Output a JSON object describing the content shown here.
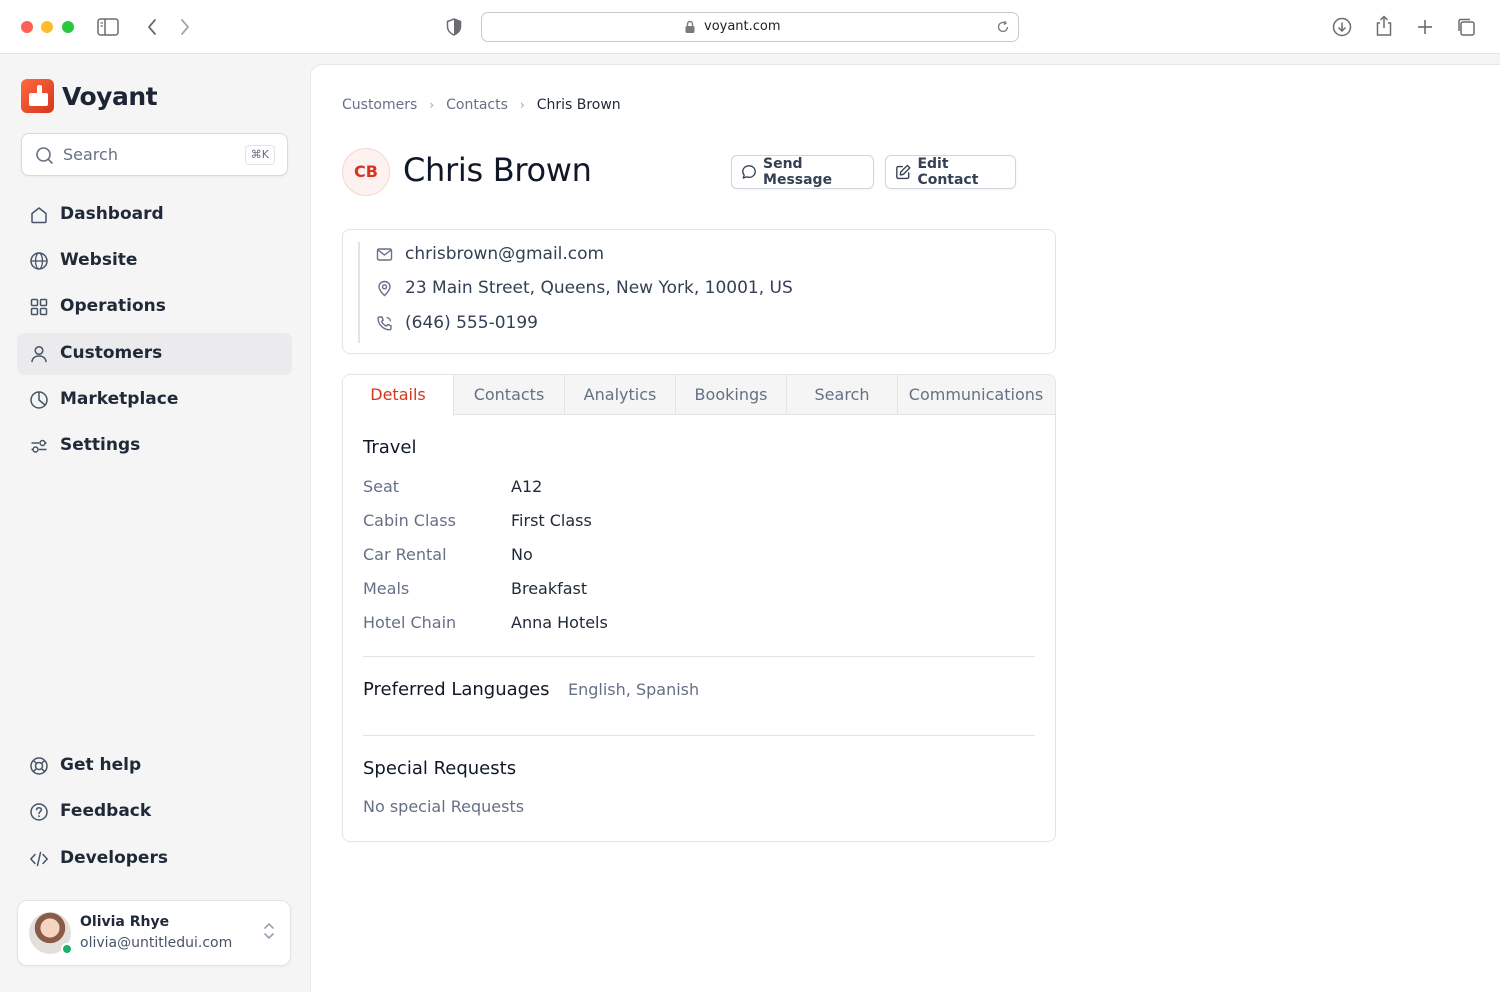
{
  "browser": {
    "url": "voyant.com"
  },
  "brand": {
    "name": "Voyant"
  },
  "search": {
    "placeholder": "Search",
    "shortcut": "⌘K"
  },
  "nav": {
    "primary": [
      {
        "label": "Dashboard",
        "icon": "home-icon"
      },
      {
        "label": "Website",
        "icon": "globe-icon"
      },
      {
        "label": "Operations",
        "icon": "grid-icon"
      },
      {
        "label": "Customers",
        "icon": "user-icon",
        "active": true
      },
      {
        "label": "Marketplace",
        "icon": "pie-chart-icon"
      },
      {
        "label": "Settings",
        "icon": "sliders-icon"
      }
    ],
    "secondary": [
      {
        "label": "Get help",
        "icon": "life-buoy-icon"
      },
      {
        "label": "Feedback",
        "icon": "help-circle-icon"
      },
      {
        "label": "Developers",
        "icon": "code-icon"
      }
    ]
  },
  "user": {
    "name": "Olivia Rhye",
    "email": "olivia@untitledui.com",
    "status_color": "#17b26a"
  },
  "breadcrumb": [
    "Customers",
    "Contacts",
    "Chris Brown"
  ],
  "contact": {
    "initials": "CB",
    "name": "Chris Brown",
    "email": "chrisbrown@gmail.com",
    "address": "23 Main Street, Queens, New York, 10001, US",
    "phone": "(646) 555-0199"
  },
  "actions": {
    "send_message": "Send Message",
    "edit_contact": "Edit Contact"
  },
  "tabs": [
    "Details",
    "Contacts",
    "Analytics",
    "Bookings",
    "Search",
    "Communications"
  ],
  "details": {
    "travel_title": "Travel",
    "travel": [
      {
        "key": "Seat",
        "value": "A12"
      },
      {
        "key": "Cabin Class",
        "value": "First Class"
      },
      {
        "key": "Car Rental",
        "value": "No"
      },
      {
        "key": "Meals",
        "value": "Breakfast"
      },
      {
        "key": "Hotel Chain",
        "value": "Anna Hotels"
      }
    ],
    "languages_title": "Preferred Languages",
    "languages": "English, Spanish",
    "requests_title": "Special Requests",
    "requests": "No special Requests"
  },
  "colors": {
    "accent": "#d6351d",
    "sidebar_bg": "#f5f5f6"
  }
}
